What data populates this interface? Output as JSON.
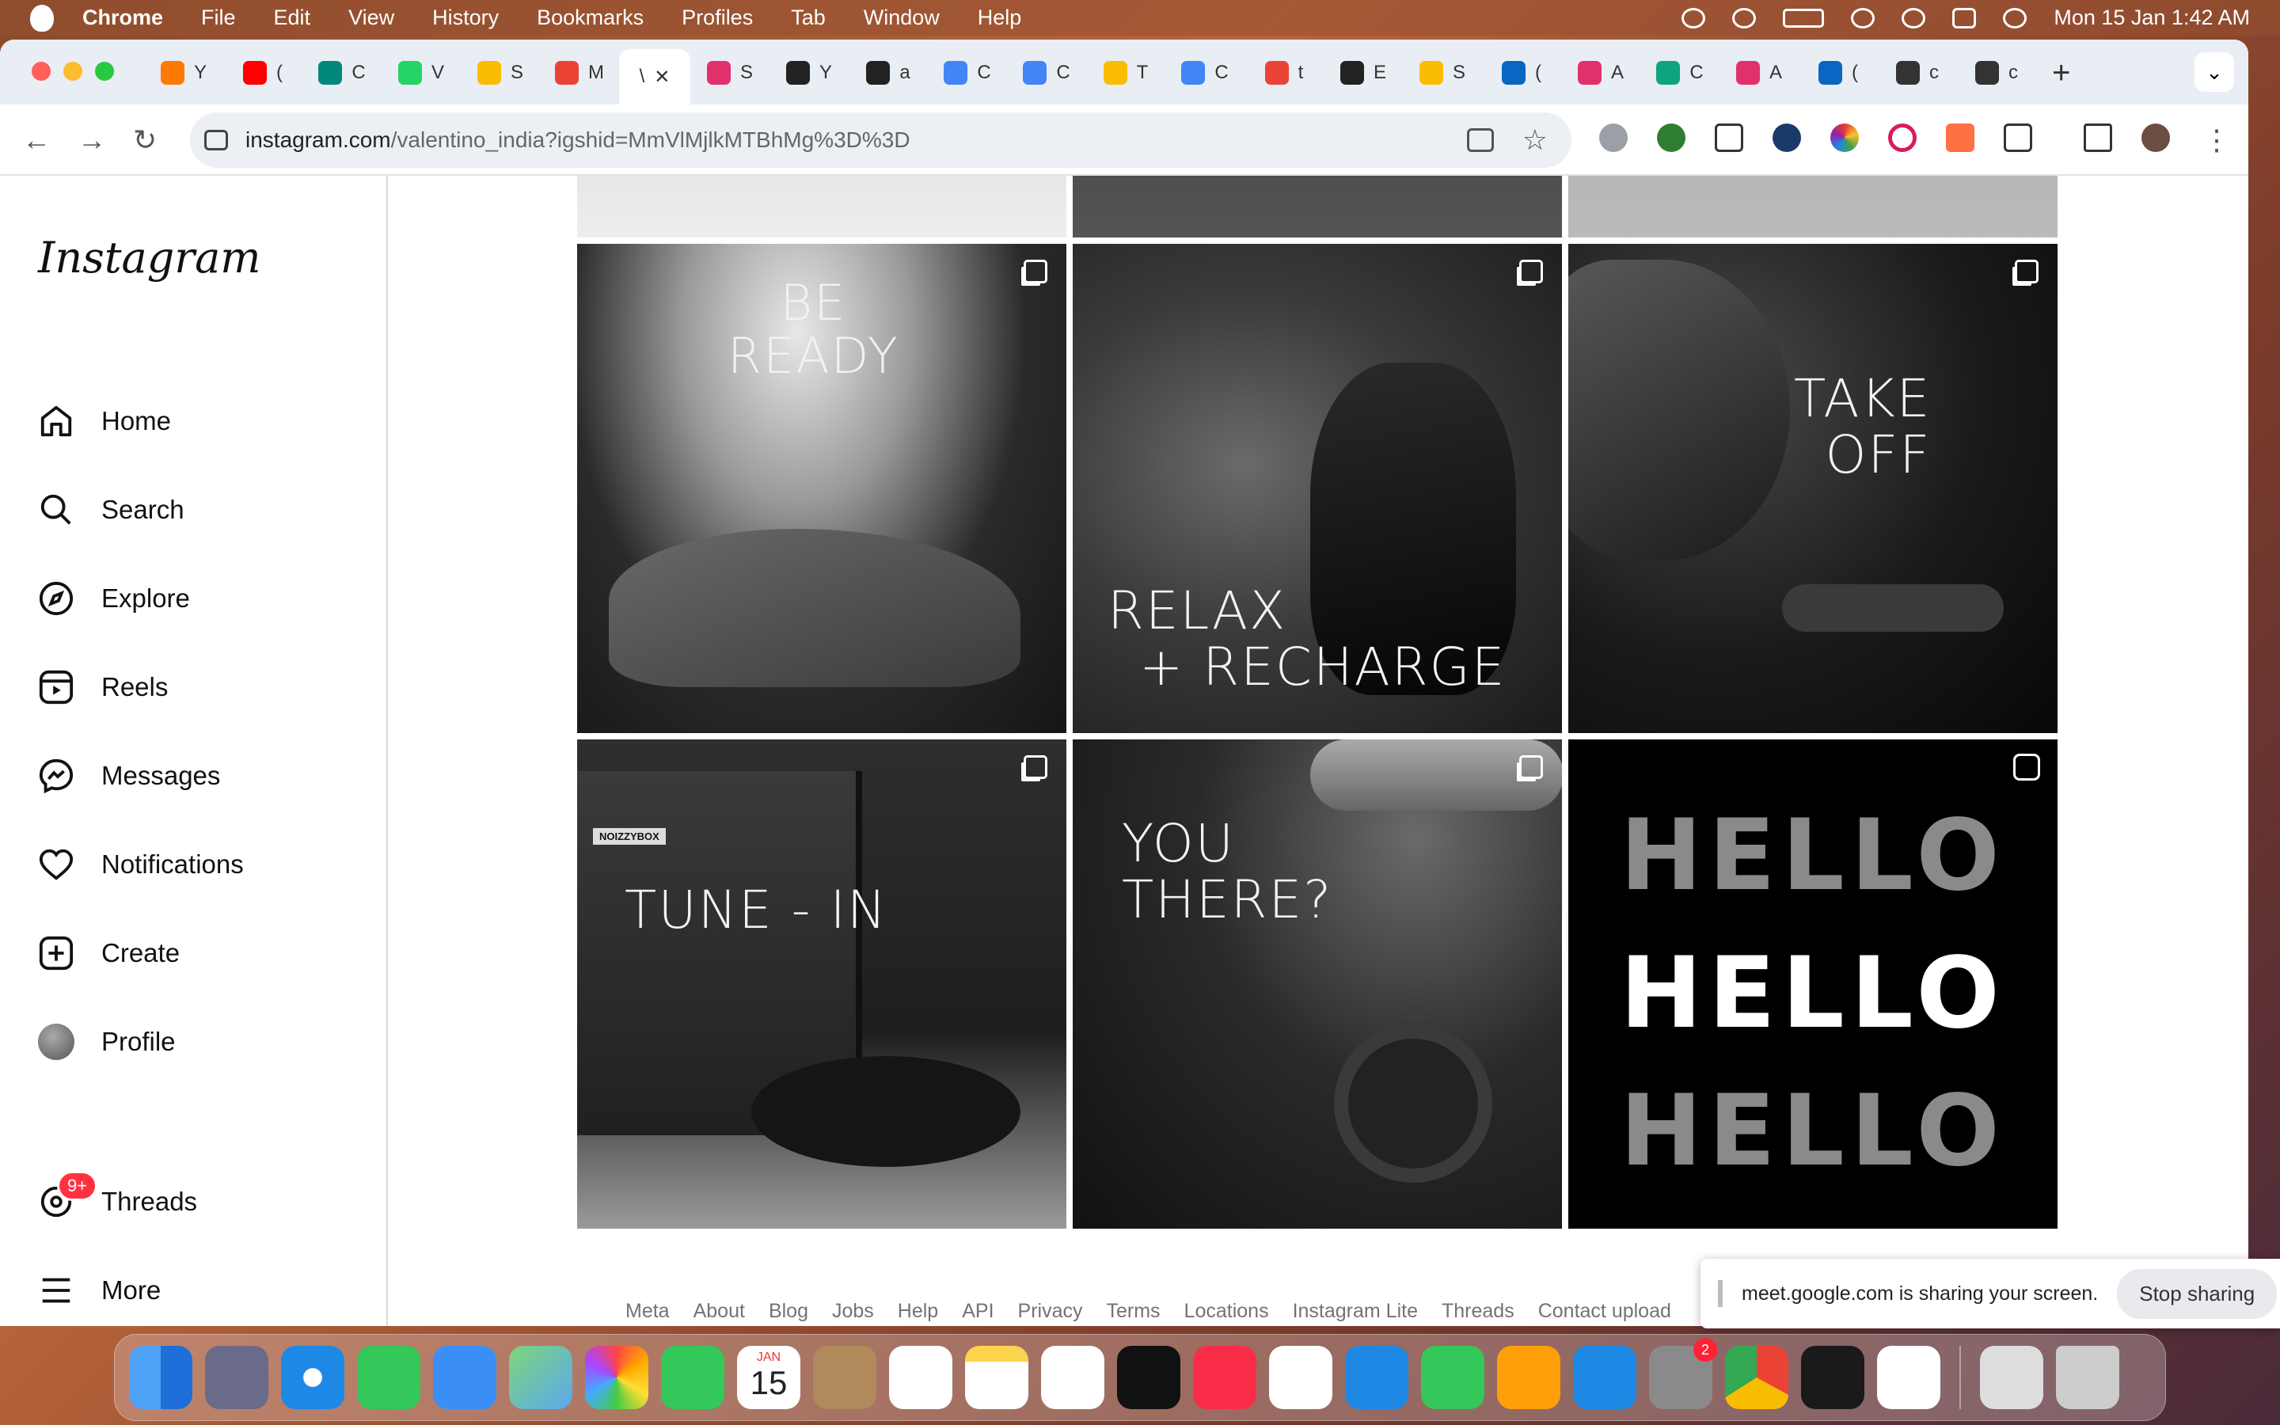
{
  "menubar": {
    "app": "Chrome",
    "items": [
      "File",
      "Edit",
      "View",
      "History",
      "Bookmarks",
      "Profiles",
      "Tab",
      "Window",
      "Help"
    ],
    "clock": "Mon 15 Jan  1:42 AM"
  },
  "browser": {
    "tabs": [
      {
        "icon": "youtube-music-icon",
        "title": "Y",
        "color": "#ff7a00"
      },
      {
        "icon": "youtube-icon",
        "title": "(",
        "color": "#ff0000"
      },
      {
        "icon": "meet-icon",
        "title": "C",
        "color": "#00897b"
      },
      {
        "icon": "whatsapp-icon",
        "title": "V",
        "color": "#25d366"
      },
      {
        "icon": "drive-icon",
        "title": "S",
        "color": "#fbbc04"
      },
      {
        "icon": "meet-record-icon",
        "title": "M",
        "color": "#ea4335"
      },
      {
        "icon": "active-tab-icon",
        "title": "\\",
        "color": "#ffffff"
      },
      {
        "icon": "instagram-icon",
        "title": "S",
        "color": "#e1306c"
      },
      {
        "icon": "github-icon",
        "title": "Y",
        "color": "#222222"
      },
      {
        "icon": "github-icon",
        "title": "a",
        "color": "#222222"
      },
      {
        "icon": "pencil-icon",
        "title": "C",
        "color": "#4285f4"
      },
      {
        "icon": "pencil-icon",
        "title": "C",
        "color": "#4285f4"
      },
      {
        "icon": "drive-icon",
        "title": "T",
        "color": "#fbbc04"
      },
      {
        "icon": "pencil-icon",
        "title": "C",
        "color": "#4285f4"
      },
      {
        "icon": "gmail-icon",
        "title": "t",
        "color": "#ea4335"
      },
      {
        "icon": "github-icon",
        "title": "E",
        "color": "#222222"
      },
      {
        "icon": "drive-icon",
        "title": "S",
        "color": "#fbbc04"
      },
      {
        "icon": "linkedin-icon",
        "title": "(",
        "color": "#0a66c2"
      },
      {
        "icon": "instagram-icon",
        "title": "A",
        "color": "#e1306c"
      },
      {
        "icon": "chatgpt-icon",
        "title": "C",
        "color": "#10a37f"
      },
      {
        "icon": "instagram-icon",
        "title": "A",
        "color": "#e1306c"
      },
      {
        "icon": "linkedin-icon",
        "title": "(",
        "color": "#0a66c2"
      },
      {
        "icon": "globe-icon",
        "title": "c",
        "color": "#333333"
      },
      {
        "icon": "globe-icon",
        "title": "c",
        "color": "#333333"
      }
    ],
    "new_tab": "+",
    "url_host": "instagram.com",
    "url_path": "/valentino_india?igshid=MmVlMjlkMTBhMg%3D%3D"
  },
  "instagram": {
    "logo": "Instagram",
    "nav": [
      {
        "name": "home",
        "label": "Home"
      },
      {
        "name": "search",
        "label": "Search"
      },
      {
        "name": "explore",
        "label": "Explore"
      },
      {
        "name": "reels",
        "label": "Reels"
      },
      {
        "name": "messages",
        "label": "Messages"
      },
      {
        "name": "notifications",
        "label": "Notifications"
      },
      {
        "name": "create",
        "label": "Create"
      },
      {
        "name": "profile",
        "label": "Profile"
      }
    ],
    "threads": {
      "label": "Threads",
      "badge": "9+"
    },
    "more": "More",
    "posts": [
      {
        "lines": [
          "BE",
          "READY"
        ]
      },
      {
        "lines": [
          "RELAX",
          "+ RECHARGE"
        ]
      },
      {
        "lines": [
          "TAKE",
          "OFF"
        ]
      },
      {
        "lines": [
          "TUNE - IN"
        ],
        "brand": "NOIZZYBOX"
      },
      {
        "lines": [
          "YOU",
          "THERE?"
        ]
      },
      {
        "lines": [
          "HELLO",
          "HELLO",
          "HELLO"
        ]
      }
    ],
    "footer": [
      "Meta",
      "About",
      "Blog",
      "Jobs",
      "Help",
      "API",
      "Privacy",
      "Terms",
      "Locations",
      "Instagram Lite",
      "Threads",
      "Contact upload"
    ]
  },
  "share_bar": {
    "message": "meet.google.com is sharing your screen.",
    "stop_label": "Stop sharing"
  },
  "dock": {
    "calendar": {
      "month": "JAN",
      "day": "15"
    },
    "settings_badge": "2"
  }
}
